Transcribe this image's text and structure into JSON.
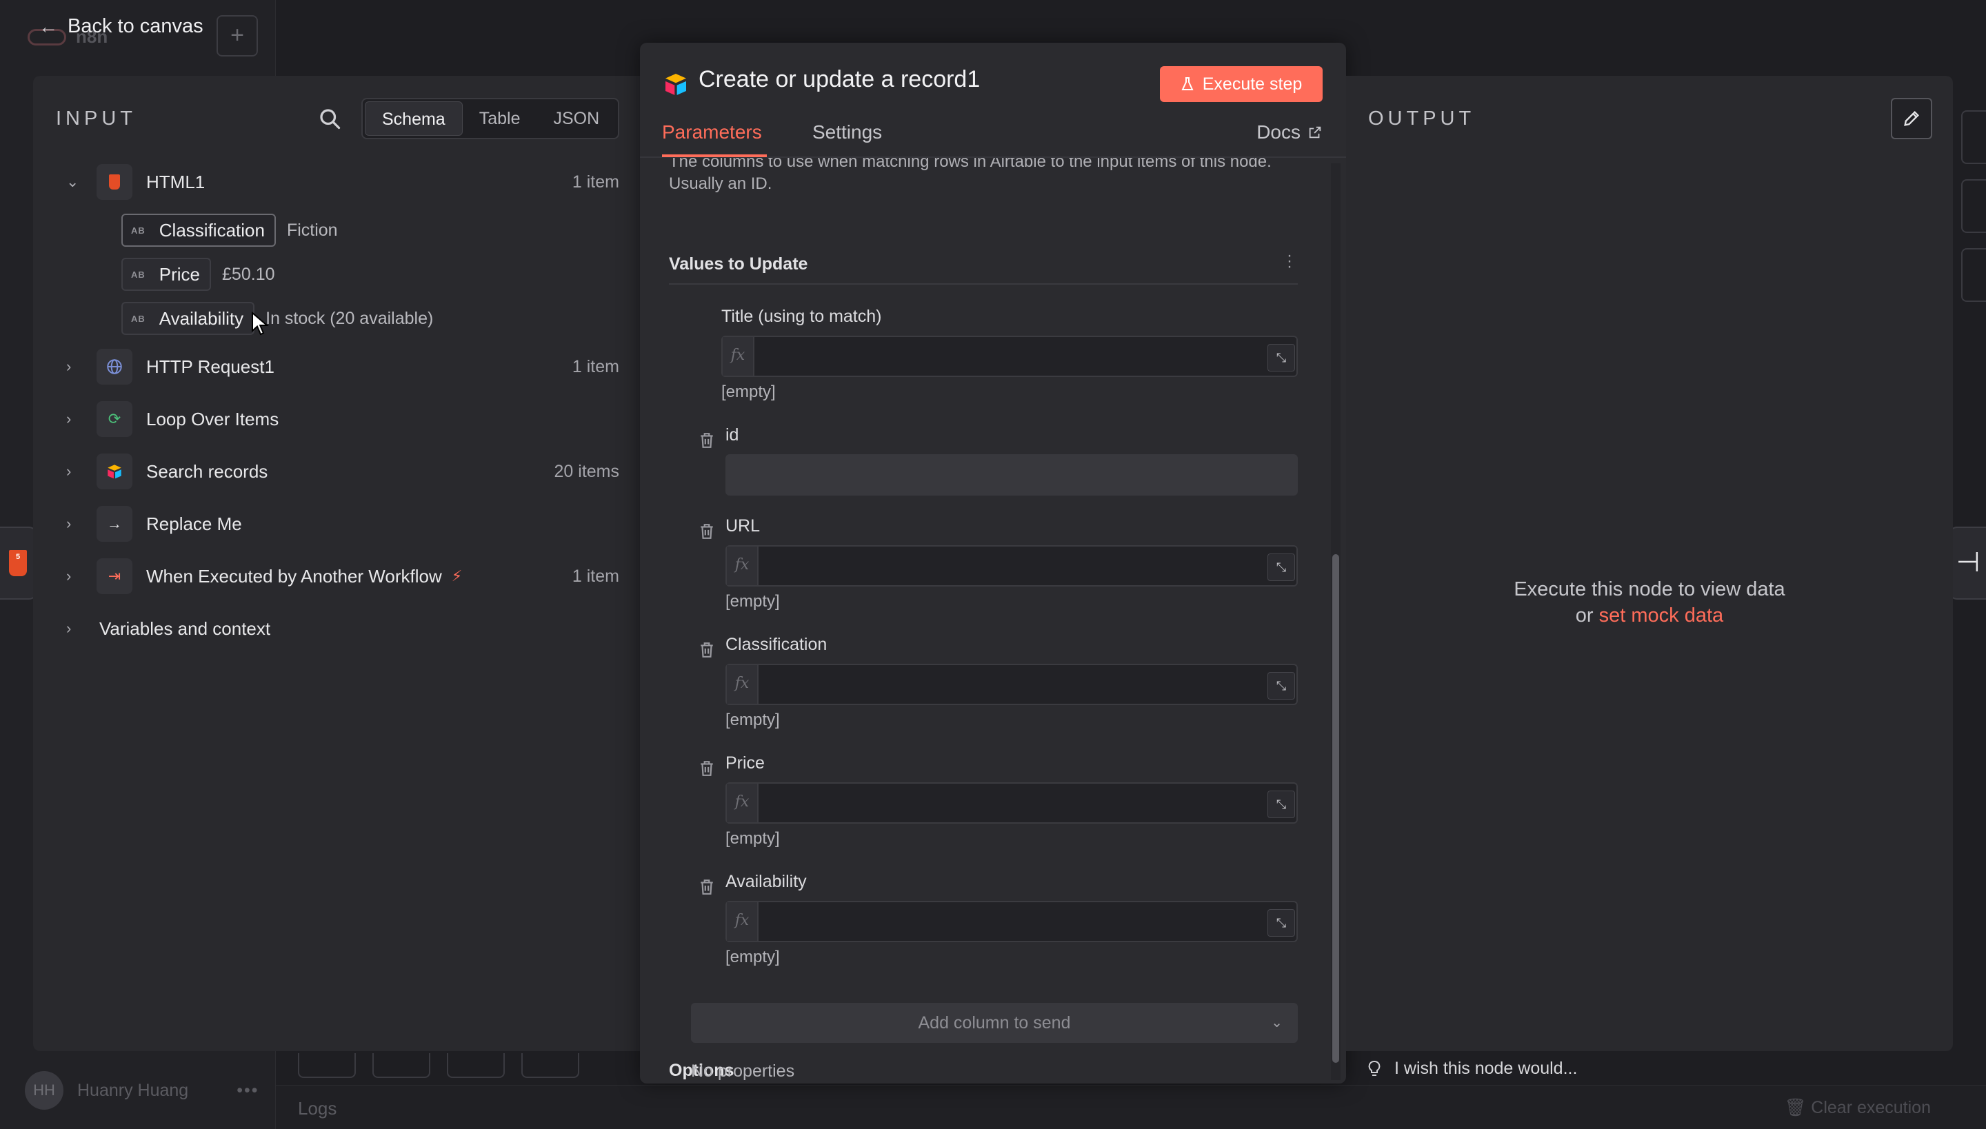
{
  "background": {
    "brand": "n8n",
    "user_initials": "HH",
    "user_name": "Huanry Huang",
    "logs_label": "Logs",
    "clear_execution": "Clear execution"
  },
  "nav": {
    "back_label": "Back to canvas"
  },
  "input_panel": {
    "title": "INPUT",
    "view_modes": [
      "Schema",
      "Table",
      "JSON"
    ],
    "active_mode": "Schema",
    "nodes": [
      {
        "name": "HTML1",
        "count": "1 item",
        "expanded": true,
        "icon": "html5-icon"
      },
      {
        "name": "HTTP Request1",
        "count": "1 item",
        "icon": "globe-icon"
      },
      {
        "name": "Loop Over Items",
        "count": "",
        "icon": "loop-icon"
      },
      {
        "name": "Search records",
        "count": "20 items",
        "icon": "airtable-icon"
      },
      {
        "name": "Replace Me",
        "count": "",
        "icon": "arrow-right-icon"
      },
      {
        "name": "When Executed by Another Workflow",
        "count": "1 item",
        "icon": "sign-in-icon"
      },
      {
        "name": "Variables and context",
        "count": ""
      }
    ],
    "fields": [
      {
        "type": "AB",
        "name": "Classification",
        "value": "Fiction"
      },
      {
        "type": "AB",
        "name": "Price",
        "value": "£50.10"
      },
      {
        "type": "AB",
        "name": "Availability",
        "value": "In stock (20 available)"
      }
    ]
  },
  "node_panel": {
    "title": "Create or update a record1",
    "execute_label": "Execute step",
    "tabs": [
      "Parameters",
      "Settings"
    ],
    "active_tab": "Parameters",
    "docs_label": "Docs",
    "help_text": "The columns to use when matching rows in Airtable to the input items of this node. Usually an ID.",
    "values_section": "Values to Update",
    "fields": [
      {
        "label": "Title (using to match)",
        "empty": "[empty]"
      },
      {
        "label": "id",
        "empty": ""
      },
      {
        "label": "URL",
        "empty": "[empty]"
      },
      {
        "label": "Classification",
        "empty": "[empty]"
      },
      {
        "label": "Price",
        "empty": "[empty]"
      },
      {
        "label": "Availability",
        "empty": "[empty]"
      }
    ],
    "fx_label": "fx",
    "add_column_label": "Add column to send",
    "options_section": "Options",
    "no_properties": "No properties"
  },
  "output_panel": {
    "title": "OUTPUT",
    "message": "Execute this node to view data",
    "or": "or",
    "mock_link": "set mock data",
    "feedback": "I wish this node would..."
  },
  "colors": {
    "accent": "#ff6d5a",
    "panel_bg": "#29292d",
    "page_bg": "#1e1e22"
  }
}
